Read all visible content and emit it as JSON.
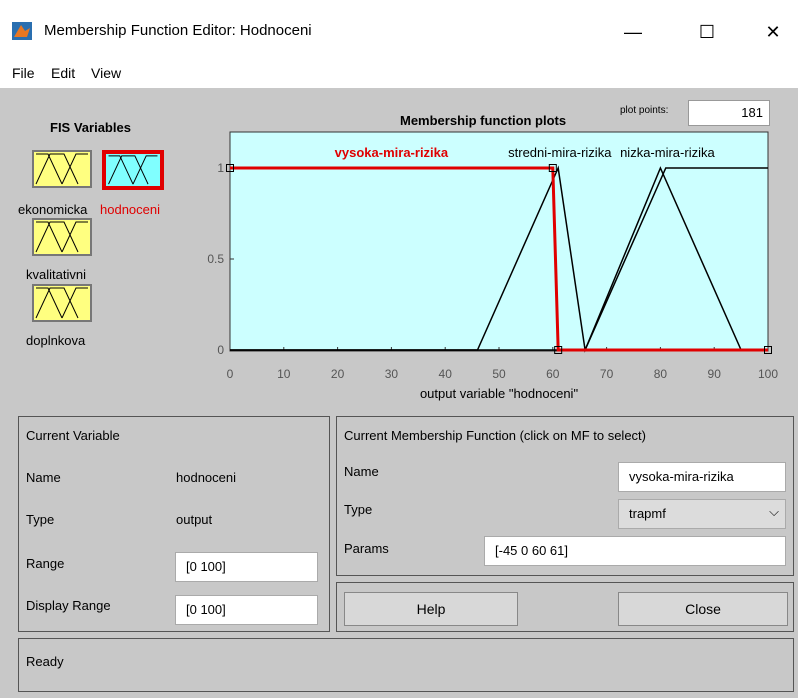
{
  "window": {
    "title": "Membership Function Editor: Hodnoceni",
    "minimize": "—",
    "maximize": "☐",
    "close": "✕"
  },
  "menu": [
    "File",
    "Edit",
    "View"
  ],
  "fis_variables": {
    "title": "FIS Variables",
    "items": [
      {
        "label": "ekonomicka",
        "selected": false
      },
      {
        "label": "hodnoceni",
        "selected": true
      },
      {
        "label": "kvalitativni",
        "selected": false
      },
      {
        "label": "doplnkova",
        "selected": false
      }
    ]
  },
  "plot": {
    "title": "Membership function plots",
    "plot_points_label": "plot points:",
    "plot_points_value": "181",
    "xlabel": "output variable \"hodnoceni\"",
    "x_ticks": [
      "0",
      "10",
      "20",
      "30",
      "40",
      "50",
      "60",
      "70",
      "80",
      "90",
      "100"
    ],
    "y_ticks": [
      "0",
      "0.5",
      "1"
    ]
  },
  "chart_data": {
    "type": "line",
    "xlim": [
      0,
      100
    ],
    "ylim": [
      0,
      1
    ],
    "series": [
      {
        "name": "vysoka-mira-rizika",
        "selected": true,
        "color": "#e00000",
        "x": [
          0,
          60,
          61,
          100
        ],
        "y": [
          1,
          1,
          0,
          0
        ]
      },
      {
        "name": "stredni-mira-rizika",
        "selected": false,
        "color": "#000000",
        "x": [
          0,
          46,
          61,
          66,
          80,
          95,
          100
        ],
        "y": [
          0,
          0,
          1,
          0,
          1,
          0,
          0
        ]
      },
      {
        "name": "nizka-mira-rizika",
        "selected": false,
        "color": "#000000",
        "x": [
          0,
          66,
          81,
          100
        ],
        "y": [
          0,
          0,
          1,
          1
        ]
      }
    ]
  },
  "current_variable": {
    "title": "Current Variable",
    "name_label": "Name",
    "name_value": "hodnoceni",
    "type_label": "Type",
    "type_value": "output",
    "range_label": "Range",
    "range_value": "[0 100]",
    "display_range_label": "Display Range",
    "display_range_value": "[0 100]"
  },
  "current_mf": {
    "title": "Current Membership Function (click on MF to select)",
    "name_label": "Name",
    "name_value": "vysoka-mira-rizika",
    "type_label": "Type",
    "type_value": "trapmf",
    "params_label": "Params",
    "params_value": "[-45 0 60 61]"
  },
  "buttons": {
    "help": "Help",
    "close": "Close"
  },
  "status": "Ready",
  "colors": {
    "plot_bg": "#ccffff",
    "selected": "#e00000",
    "var_icon": "#ffff80",
    "var_icon_selected": "#80ffff"
  }
}
